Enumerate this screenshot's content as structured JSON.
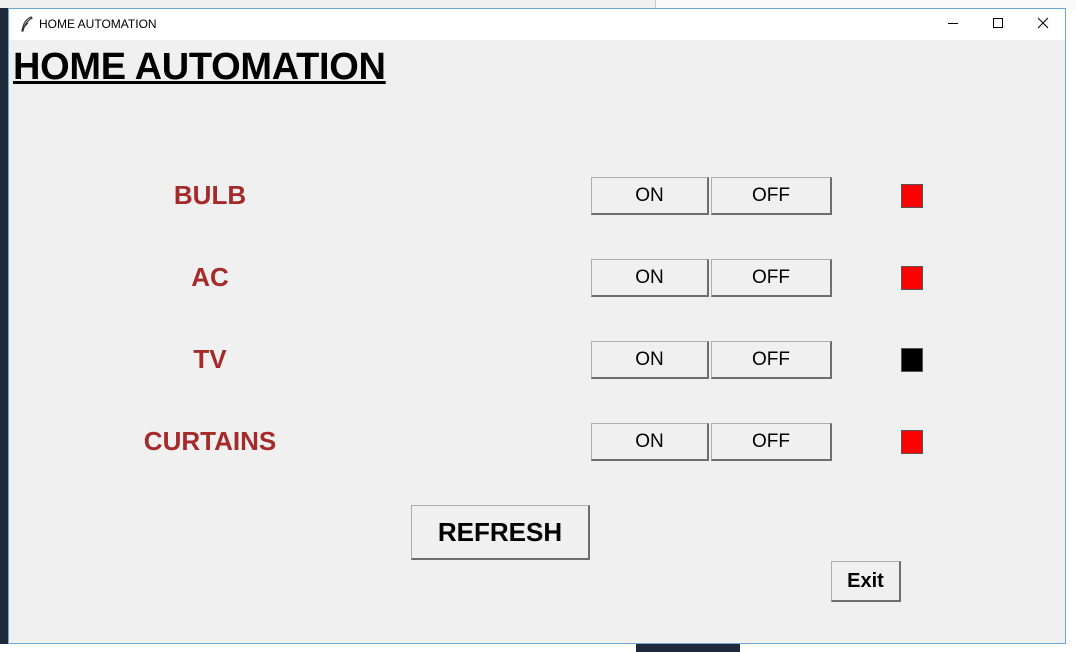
{
  "window": {
    "title": "HOME AUTOMATION"
  },
  "app": {
    "heading": "HOME AUTOMATION"
  },
  "devices": [
    {
      "label": "BULB",
      "on_label": "ON",
      "off_label": "OFF",
      "indicator_color": "#ff0000"
    },
    {
      "label": "AC",
      "on_label": "ON",
      "off_label": "OFF",
      "indicator_color": "#ff0000"
    },
    {
      "label": "TV",
      "on_label": "ON",
      "off_label": "OFF",
      "indicator_color": "#000000"
    },
    {
      "label": "CURTAINS",
      "on_label": "ON",
      "off_label": "OFF",
      "indicator_color": "#ff0000"
    }
  ],
  "actions": {
    "refresh_label": "REFRESH",
    "exit_label": "Exit"
  },
  "colors": {
    "label_color": "#a52a2a",
    "window_bg": "#f0f0f0"
  }
}
